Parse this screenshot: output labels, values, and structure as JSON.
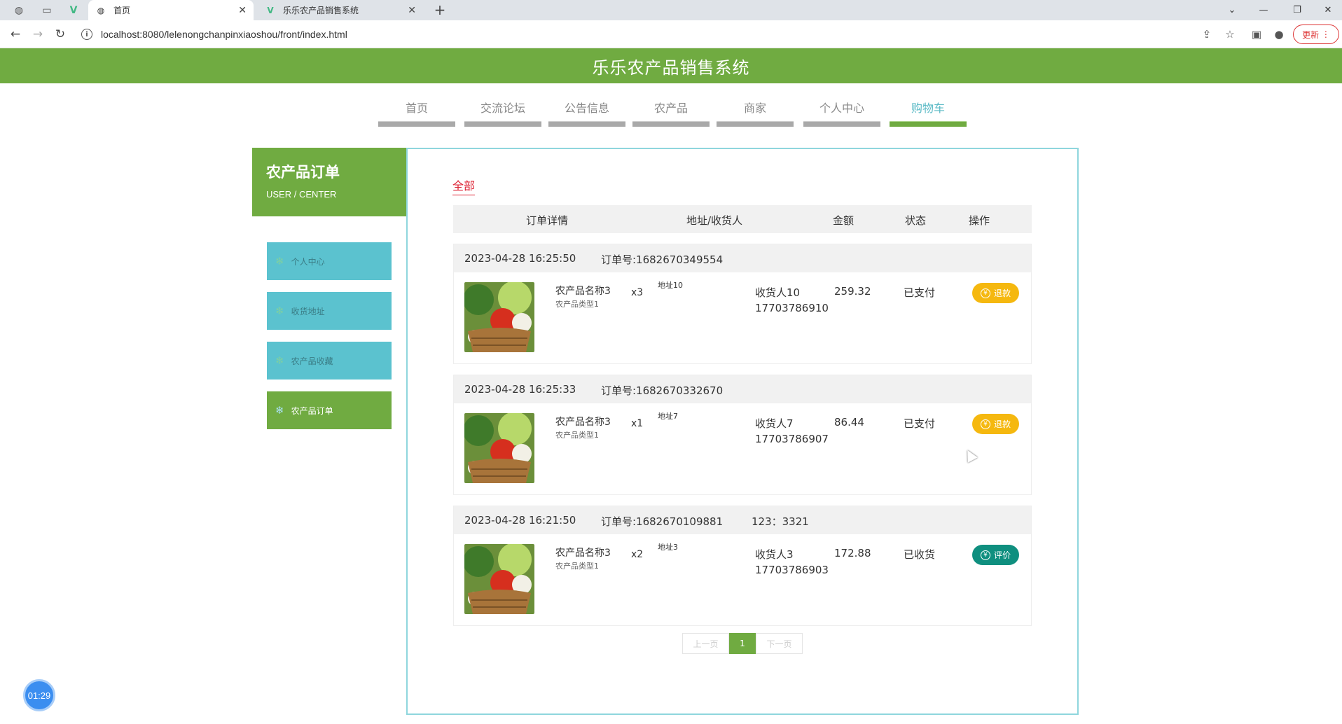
{
  "browser": {
    "tabs": [
      {
        "title": "首页",
        "icon": "globe-icon"
      },
      {
        "title": "乐乐农产品销售系统",
        "icon": "vue-logo-icon"
      }
    ],
    "new_tab": "+",
    "url": "localhost:8080/lelenongchanpinxiaoshou/front/index.html",
    "update_label": "更新"
  },
  "site": {
    "title": "乐乐农产品销售系统",
    "nav": [
      "首页",
      "交流论坛",
      "公告信息",
      "农产品",
      "商家",
      "个人中心",
      "购物车"
    ],
    "active_nav": "购物车"
  },
  "sidebar": {
    "title": "农产品订单",
    "subtitle": "USER / CENTER",
    "items": [
      "个人中心",
      "收货地址",
      "农产品收藏",
      "农产品订单"
    ],
    "active_item": "农产品订单"
  },
  "orders": {
    "filter_label": "全部",
    "columns": [
      "订单详情",
      "地址/收货人",
      "金额",
      "状态",
      "操作"
    ],
    "list": [
      {
        "time": "2023-04-28 16:25:50",
        "order_no": "订单号:1682670349554",
        "extra": "",
        "product_name": "农产品名称3",
        "product_type": "农产品类型1",
        "qty": "x3",
        "address": "地址10",
        "receiver": "收货人10",
        "phone": "17703786910",
        "amount": "259.32",
        "status": "已支付",
        "action": "退款"
      },
      {
        "time": "2023-04-28 16:25:33",
        "order_no": "订单号:1682670332670",
        "extra": "",
        "product_name": "农产品名称3",
        "product_type": "农产品类型1",
        "qty": "x1",
        "address": "地址7",
        "receiver": "收货人7",
        "phone": "17703786907",
        "amount": "86.44",
        "status": "已支付",
        "action": "退款"
      },
      {
        "time": "2023-04-28 16:21:50",
        "order_no": "订单号:1682670109881",
        "extra": "123：3321",
        "product_name": "农产品名称3",
        "product_type": "农产品类型1",
        "qty": "x2",
        "address": "地址3",
        "receiver": "收货人3",
        "phone": "17703786903",
        "amount": "172.88",
        "status": "已收货",
        "action": "评价"
      }
    ]
  },
  "pager": {
    "prev": "上一页",
    "current": "1",
    "next": "下一页"
  },
  "timer": "01:29",
  "colors": {
    "brand_green": "#70ab41",
    "teal": "#5bc2cf",
    "refund": "#f5b80f",
    "review": "#0f8f7f",
    "filter_red": "#d23"
  }
}
